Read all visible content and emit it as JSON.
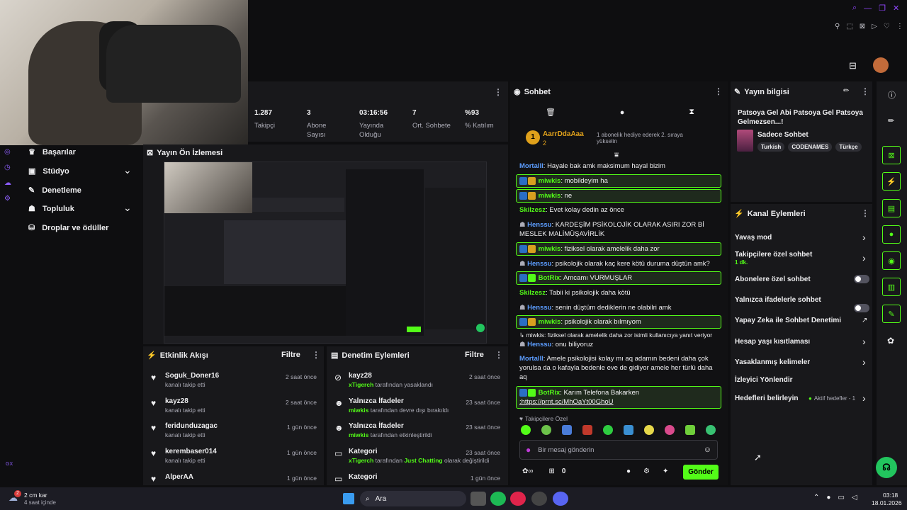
{
  "colors": {
    "accent": "#53fc18",
    "bg": "#0e0e10",
    "panel": "#18181b"
  },
  "nav": {
    "items": [
      {
        "label": "Başarılar",
        "icon": "trophy-icon"
      },
      {
        "label": "Stüdyo",
        "icon": "studio-icon"
      },
      {
        "label": "Denetleme",
        "icon": "wrench-icon"
      },
      {
        "label": "Topluluk",
        "icon": "community-icon"
      },
      {
        "label": "Droplar ve ödüller",
        "icon": "drops-icon"
      }
    ]
  },
  "stats": [
    {
      "value": "1.287",
      "label": "Takipçi"
    },
    {
      "value": "3",
      "label": "Abone Sayısı"
    },
    {
      "value": "03:16:56",
      "label": "Yayında Olduğu"
    },
    {
      "value": "7",
      "label": "Ort. Sohbete"
    },
    {
      "value": "%93",
      "label": "% Katılım"
    }
  ],
  "preview": {
    "title": "Yayın Ön İzlemesi"
  },
  "chat": {
    "title": "Sohbet",
    "hype": {
      "user": "AarrDdaAaa",
      "count": "2",
      "rank": "1",
      "text": "1 abonelik hediye ederek 2. sıraya yükselin"
    },
    "messages": [
      {
        "user": "Mortalll",
        "text": "Hayale bak amk maksimum hayal bizim"
      },
      {
        "user": "miwkis",
        "text": "mobildeyim ha"
      },
      {
        "user": "miwkis",
        "text": "ne"
      },
      {
        "user": "Skilzesz",
        "text": "Evet kolay dedin az önce"
      },
      {
        "user": "Henssu",
        "text": "KARDEŞİM PSİKOLOJİK OLARAK ASIRI ZOR Bİ MESLEK MALİMÜŞAVİRLİK"
      },
      {
        "user": "miwkis",
        "text": "fiziksel olarak amelelik daha zor"
      },
      {
        "user": "Henssu",
        "text": "psikolojik olarak kaç kere kötü duruma düştün amk?"
      },
      {
        "user": "BotRix",
        "text": "Amcamı VURMUŞLAR"
      },
      {
        "user": "Skilzesz",
        "text": "Tabii ki psikolojik daha kötü"
      },
      {
        "user": "Henssu",
        "text": "senin düştüm dediklerin ne olabilri amk"
      },
      {
        "user": "miwkis",
        "text": "psikolojik olarak bılmıyom"
      },
      {
        "reply": "miwkis: fiziksel olarak amelelik daha zor isimli kullanıcıya yanıt veriyor"
      },
      {
        "user": "Henssu",
        "text": "onu biliyoruz"
      },
      {
        "user": "Mortalll",
        "text": "Amele psikolojisi kolay mı aq adamın bedeni daha çok yorulsa da o kafayla bedenle eve de gidiyor amele her türlü daha aq"
      },
      {
        "user": "BotRix",
        "text": "Karım Telefona Bakarken",
        "link": ":https://prnt.sc/MhOaYt00GhoU"
      }
    ],
    "emote_title": "Takipçilere Özel",
    "input_placeholder": "Bir mesaj gönderin",
    "points": "0",
    "send": "Gönder"
  },
  "info": {
    "title": "Yayın bilgisi",
    "stream_title": "Patsoya Gel Abi Patsoya Gel Patsoya Gelmezsen...!",
    "category": "Sadece Sohbet",
    "tags": [
      "Turkish",
      "CODENAMES",
      "Türkçe"
    ]
  },
  "actions": {
    "title": "Kanal Eylemleri",
    "items": [
      {
        "label": "Yavaş mod",
        "ctl": "chevron"
      },
      {
        "label": "Takipçilere özel sohbet",
        "sub": "1 dk.",
        "ctl": "chevron"
      },
      {
        "label": "Abonelere özel sohbet",
        "ctl": "toggle"
      },
      {
        "label": "Yalnızca ifadelerle sohbet",
        "ctl": "toggle"
      },
      {
        "label": "Yapay Zeka ile Sohbet Denetimi",
        "ctl": "external"
      },
      {
        "label": "Hesap yaşı kısıtlaması",
        "ctl": "chevron"
      },
      {
        "label": "Yasaklanmış kelimeler",
        "ctl": "chevron"
      },
      {
        "label": "İzleyici Yönlendir",
        "ctl": "none"
      },
      {
        "label": "Hedefleri belirleyin",
        "extra": "Aktif hedefler - 1",
        "ctl": "chevron"
      }
    ]
  },
  "activity": {
    "title": "Etkinlik Akışı",
    "filter": "Filtre",
    "items": [
      {
        "name": "Soguk_Doner16",
        "sub": "kanalı takip etti",
        "time": "2 saat önce"
      },
      {
        "name": "kayz28",
        "sub": "kanalı takip etti",
        "time": "2 saat önce"
      },
      {
        "name": "feridunduzagac",
        "sub": "kanalı takip etti",
        "time": "1 gün önce"
      },
      {
        "name": "kerembaser014",
        "sub": "kanalı takip etti",
        "time": "1 gün önce"
      },
      {
        "name": "AlperAA",
        "sub": "",
        "time": "1 gün önce"
      }
    ]
  },
  "moderation": {
    "title": "Denetim Eylemleri",
    "filter": "Filtre",
    "items": [
      {
        "name": "kayz28",
        "actor": "xTigerch",
        "sub": "tarafından yasaklandı",
        "time": "2 saat önce"
      },
      {
        "name": "Yalnızca İfadeler",
        "actor": "miwkis",
        "sub": "tarafından devre dışı bırakıldı",
        "time": "23 saat önce"
      },
      {
        "name": "Yalnızca İfadeler",
        "actor": "miwkis",
        "sub": "tarafından etkinleştirildi",
        "time": "23 saat önce"
      },
      {
        "name": "Kategori",
        "actor": "xTigerch",
        "sub": "tarafından",
        "cat": "Just Chatting",
        "sub2": "olarak değiştirildi",
        "time": "23 saat önce"
      },
      {
        "name": "Kategori",
        "time": "1 gün önce"
      }
    ]
  },
  "taskbar": {
    "weather": "2 cm kar",
    "weather_sub": "4 saat içinde",
    "search": "Ara",
    "time": "03:18",
    "date": "18.01.2026",
    "notif": "2"
  }
}
